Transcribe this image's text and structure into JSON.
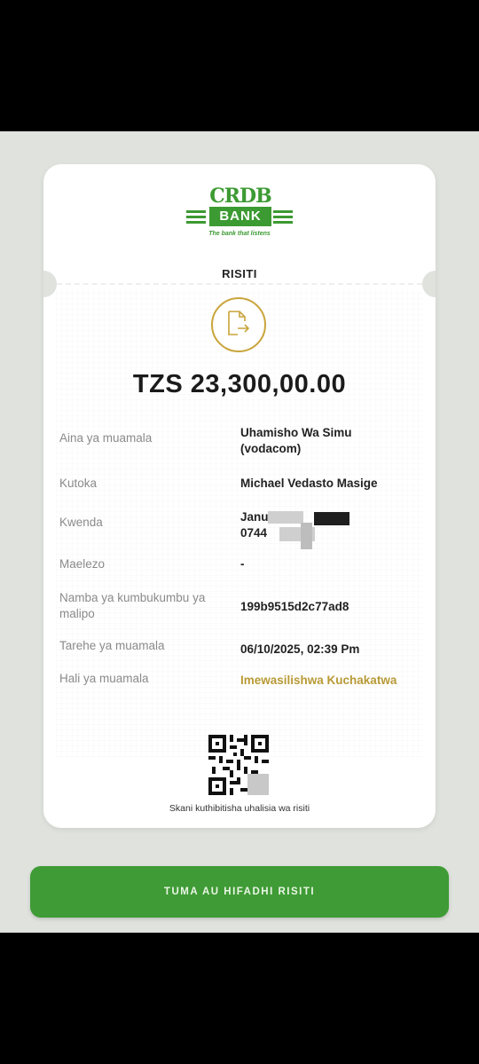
{
  "bank": {
    "logo_top": "CRDB",
    "logo_name": "BANK",
    "tagline": "The bank that listens"
  },
  "receipt": {
    "title": "RISITI",
    "icon": "document-export-icon",
    "amount": "TZS 23,300,00.00",
    "details": [
      {
        "label": "Aina ya muamala",
        "value_line1": "Uhamisho Wa Simu",
        "value_line2": "(vodacom)"
      },
      {
        "label": "Kutoka",
        "value_line1": "Michael Vedasto Masige"
      },
      {
        "label": "Kwenda",
        "value_line1": "Janu",
        "value_line2": "0744"
      },
      {
        "label": "Maelezo",
        "value_line1": "-"
      },
      {
        "label_line1": "Namba ya kumbukumbu ya",
        "label_line2": "malipo",
        "value_line1": "199b9515d2c77ad8"
      },
      {
        "label": "Tarehe ya muamala",
        "value_line1": "06/10/2025, 02:39 Pm"
      },
      {
        "label": "Hali ya muamala",
        "value_line1": "Imewasilishwa Kuchakatwa"
      }
    ],
    "qr_caption": "Skani kuthibitisha uhalisia wa risiti"
  },
  "actions": {
    "send_save_label": "TUMA AU HIFADHI RISITI"
  },
  "colors": {
    "brand_green": "#3c9a32",
    "gold": "#c9a43a",
    "status_gold": "#b89a36"
  }
}
